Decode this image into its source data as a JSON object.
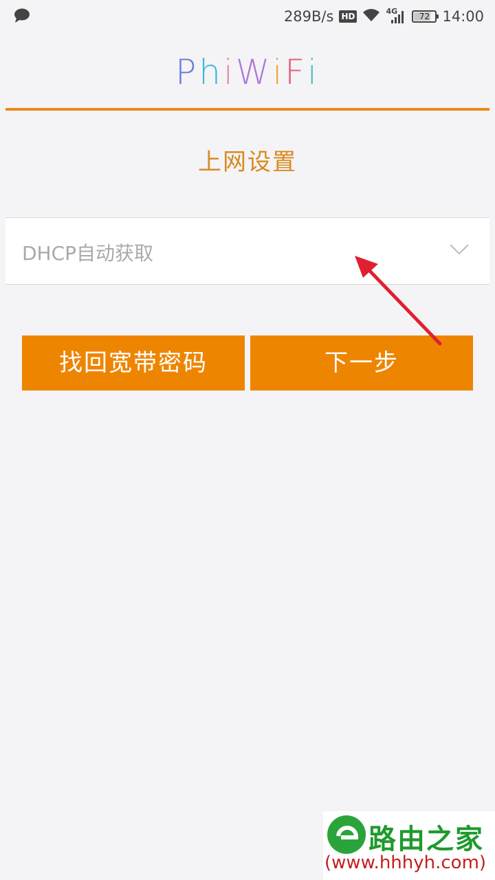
{
  "status_bar": {
    "network_speed": "289B/s",
    "hd_badge": "HD",
    "network_type": "4G",
    "battery": "72",
    "time": "14:00"
  },
  "header": {
    "logo_letters": [
      "P",
      "h",
      "i",
      "W",
      "i",
      "F",
      "i"
    ],
    "accent_color": "#e88a1a"
  },
  "page": {
    "title": "上网设置"
  },
  "connection_select": {
    "selected_value": "DHCP自动获取"
  },
  "buttons": {
    "recover_password": "找回宽带密码",
    "next": "下一步",
    "color": "#ee8500"
  },
  "watermark": {
    "brand": "路由之家",
    "url": "(www.hhhyh.com)"
  }
}
